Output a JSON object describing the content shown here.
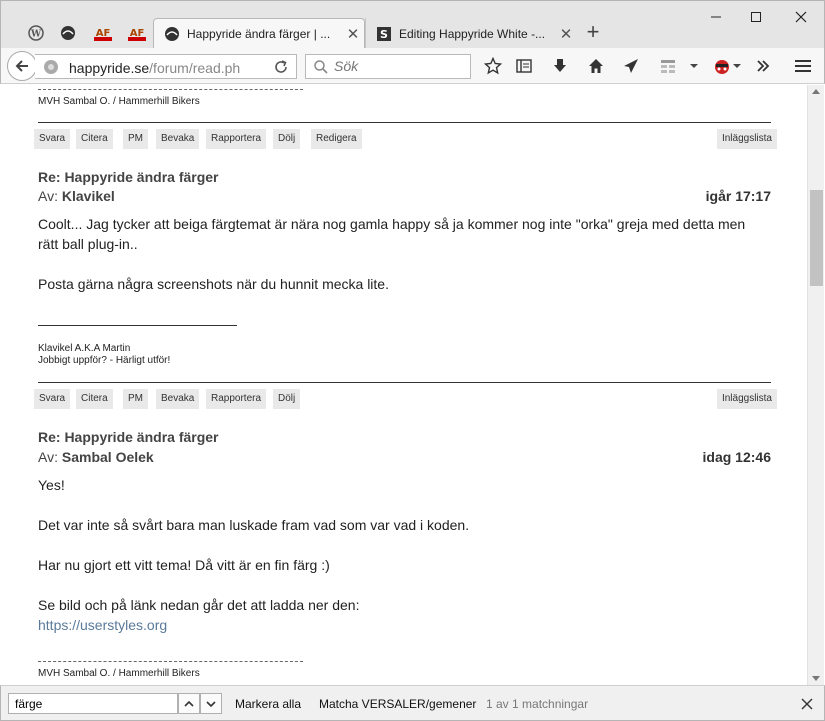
{
  "browser": {
    "tabs": [
      {
        "title": "Happyride ändra färger | ...",
        "active": true
      },
      {
        "title": "Editing Happyride White -...",
        "active": false
      }
    ],
    "address": {
      "host": "happyride.se",
      "path": "/forum/read.ph"
    },
    "search_placeholder": "Sök"
  },
  "posts": {
    "prev_signature": "MVH Sambal O. / Hammerhill Bikers",
    "actions_prev": [
      "Svara",
      "Citera",
      "PM",
      "Bevaka",
      "Rapportera",
      "Dölj",
      "Redigera"
    ],
    "post_list_label": "Inläggslista",
    "items": [
      {
        "subject": "Re: Happyride ändra färger",
        "author_prefix": "Av:",
        "author": "Klavikel",
        "date": "igår 17:17",
        "body": [
          "Coolt... Jag tycker att beiga färgtemat är nära nog gamla happy så ja kommer nog inte \"orka\" greja med detta men rätt ball plug-in..",
          "Posta gärna några screenshots när du hunnit mecka lite."
        ],
        "signature": [
          "Klavikel A.K.A Martin",
          "Jobbigt uppför? - Härligt utför!"
        ],
        "actions": [
          "Svara",
          "Citera",
          "PM",
          "Bevaka",
          "Rapportera",
          "Dölj"
        ]
      },
      {
        "subject": "Re: Happyride ändra färger",
        "author_prefix": "Av:",
        "author": "Sambal Oelek",
        "date": "idag 12:46",
        "body": [
          "Yes!",
          "Det var inte så svårt bara man luskade fram vad som var vad i koden.",
          "Har nu gjort ett vitt tema! Då vitt är en fin färg :)",
          "Se bild och på länk nedan går det att ladda ner den:"
        ],
        "link": "https://userstyles.org",
        "signature": "MVH Sambal O. / Hammerhill Bikers"
      }
    ]
  },
  "findbar": {
    "query": "färge",
    "highlight_all": "Markera alla",
    "match_case": "Matcha VERSALER/gemener",
    "status": "1 av 1 matchningar"
  }
}
